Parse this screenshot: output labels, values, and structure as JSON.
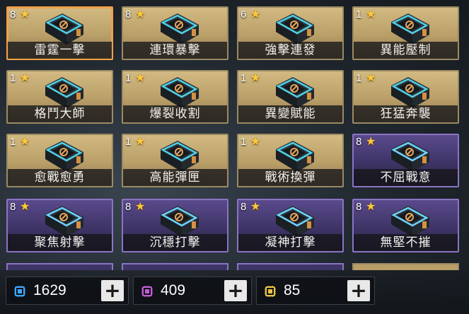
{
  "cards": [
    {
      "level": "8",
      "name": "雷霆一擊",
      "theme": "gold",
      "selected": true,
      "icon": "lightning-fist-icon"
    },
    {
      "level": "8",
      "name": "連環暴擊",
      "theme": "gold",
      "selected": false,
      "icon": "chain-strike-icon"
    },
    {
      "level": "6",
      "name": "強擊連發",
      "theme": "gold",
      "selected": false,
      "icon": "burst-fire-icon"
    },
    {
      "level": "1",
      "name": "異能壓制",
      "theme": "gold",
      "selected": false,
      "icon": "suppress-icon"
    },
    {
      "level": "1",
      "name": "格鬥大師",
      "theme": "gold",
      "selected": false,
      "icon": "combat-icon"
    },
    {
      "level": "1",
      "name": "爆裂收割",
      "theme": "gold",
      "selected": false,
      "icon": "harvest-icon"
    },
    {
      "level": "1",
      "name": "異變賦能",
      "theme": "gold",
      "selected": false,
      "icon": "mutation-icon"
    },
    {
      "level": "1",
      "name": "狂猛奔襲",
      "theme": "gold",
      "selected": false,
      "icon": "rush-icon"
    },
    {
      "level": "1",
      "name": "愈戰愈勇",
      "theme": "gold",
      "selected": false,
      "icon": "flame-icon"
    },
    {
      "level": "1",
      "name": "高能彈匣",
      "theme": "gold",
      "selected": false,
      "icon": "magazine-icon"
    },
    {
      "level": "1",
      "name": "戰術換彈",
      "theme": "gold",
      "selected": false,
      "icon": "reload-icon"
    },
    {
      "level": "8",
      "name": "不屈戰意",
      "theme": "purple",
      "selected": false,
      "icon": "shield-icon"
    },
    {
      "level": "8",
      "name": "聚焦射擊",
      "theme": "purple",
      "selected": false,
      "icon": "target-icon"
    },
    {
      "level": "8",
      "name": "沉穩打擊",
      "theme": "purple",
      "selected": false,
      "icon": "thumb-icon"
    },
    {
      "level": "8",
      "name": "凝神打擊",
      "theme": "purple",
      "selected": false,
      "icon": "arm-icon"
    },
    {
      "level": "8",
      "name": "無堅不摧",
      "theme": "purple",
      "selected": false,
      "icon": "break-icon"
    }
  ],
  "resources": [
    {
      "value": "1629",
      "icon": "blue-chip-icon",
      "color": "#3fa7ff"
    },
    {
      "value": "409",
      "icon": "purple-chip-icon",
      "color": "#c35bd6"
    },
    {
      "value": "85",
      "icon": "gold-chip-icon",
      "color": "#e8c347"
    }
  ],
  "plus_label": "+"
}
